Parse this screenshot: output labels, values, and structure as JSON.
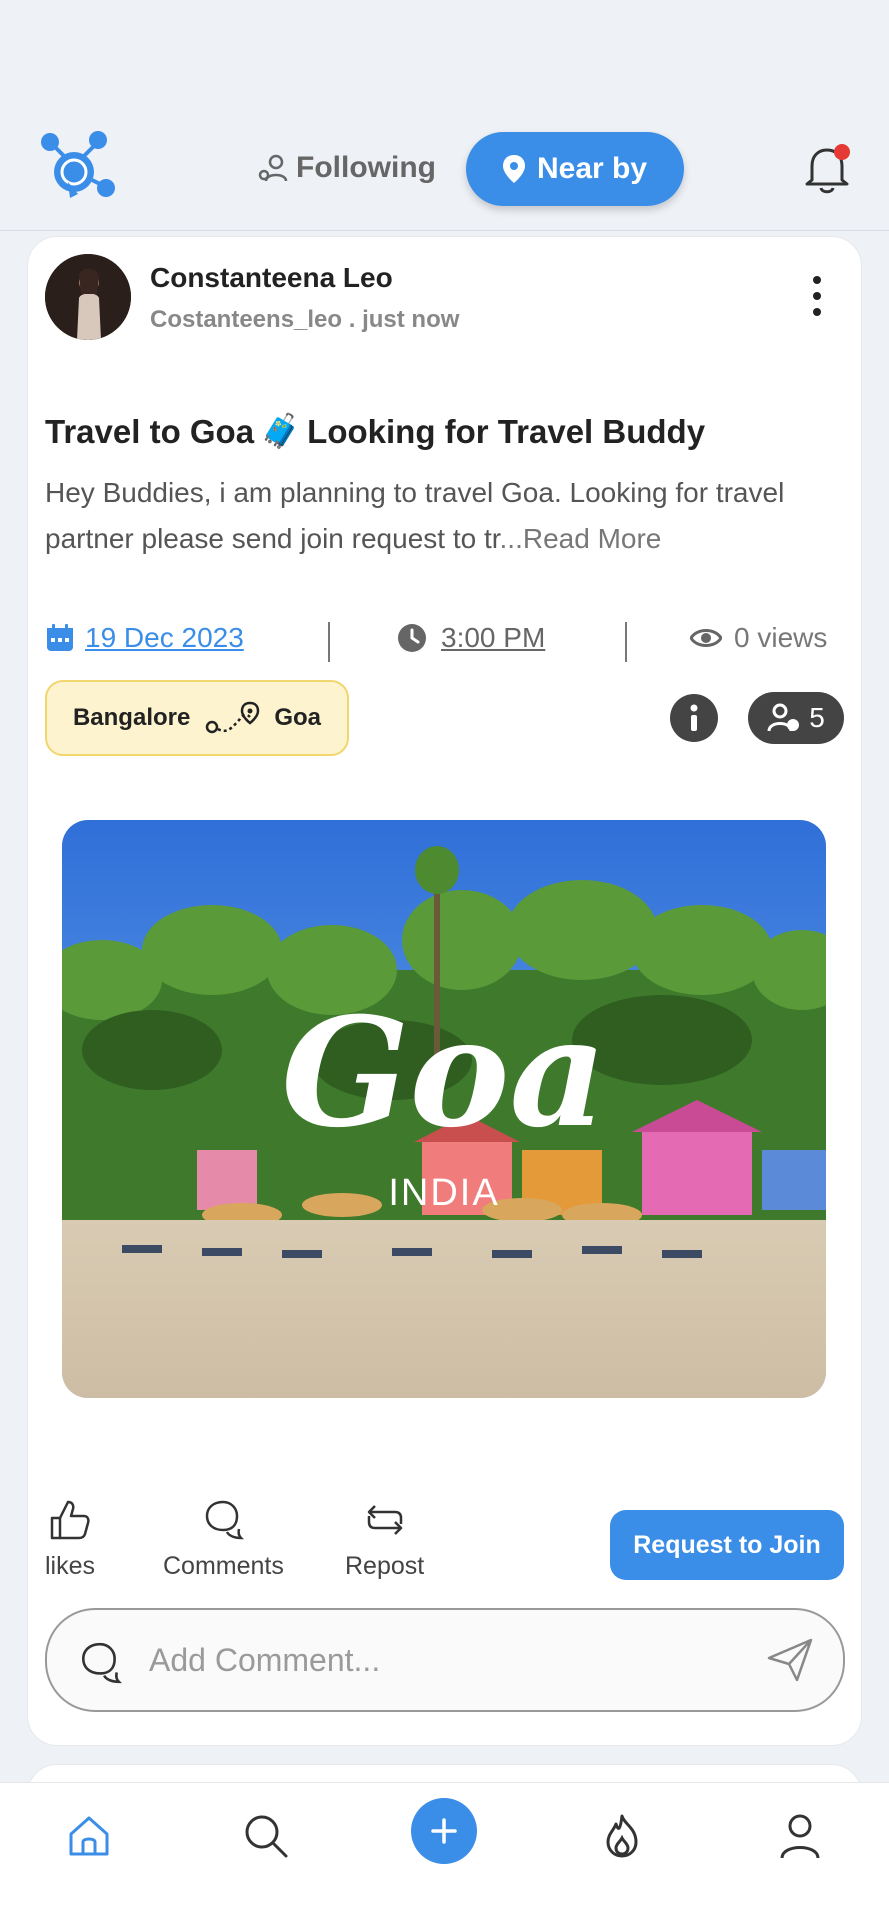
{
  "header": {
    "tab_following": "Following",
    "tab_nearby": "Near by",
    "notification_dot_color": "#e53935",
    "accent": "#3b8ee8"
  },
  "post": {
    "author_name": "Constanteena Leo",
    "author_handle": "Costanteens_leo",
    "posted": ". just now",
    "title": "Travel to Goa",
    "title_emoji": "🧳",
    "title_suffix": "Looking for Travel Buddy",
    "body": "Hey Buddies, i am planning to travel Goa. Looking for travel partner please send join request to tr",
    "read_more": "...Read More",
    "date": "19 Dec 2023",
    "time": "3:00 PM",
    "views": "0 views",
    "route_from": "Bangalore",
    "route_to": "Goa",
    "members_count": "5",
    "image_text": "Goa",
    "image_subtext": "INDIA"
  },
  "actions": {
    "likes": "likes",
    "comments": "Comments",
    "repost": "Repost",
    "join": "Request to Join"
  },
  "comment": {
    "placeholder": "Add Comment..."
  },
  "nav": {
    "items": [
      "home-icon",
      "search-icon",
      "add-icon",
      "trending-icon",
      "profile-icon"
    ],
    "active": "home-icon"
  }
}
